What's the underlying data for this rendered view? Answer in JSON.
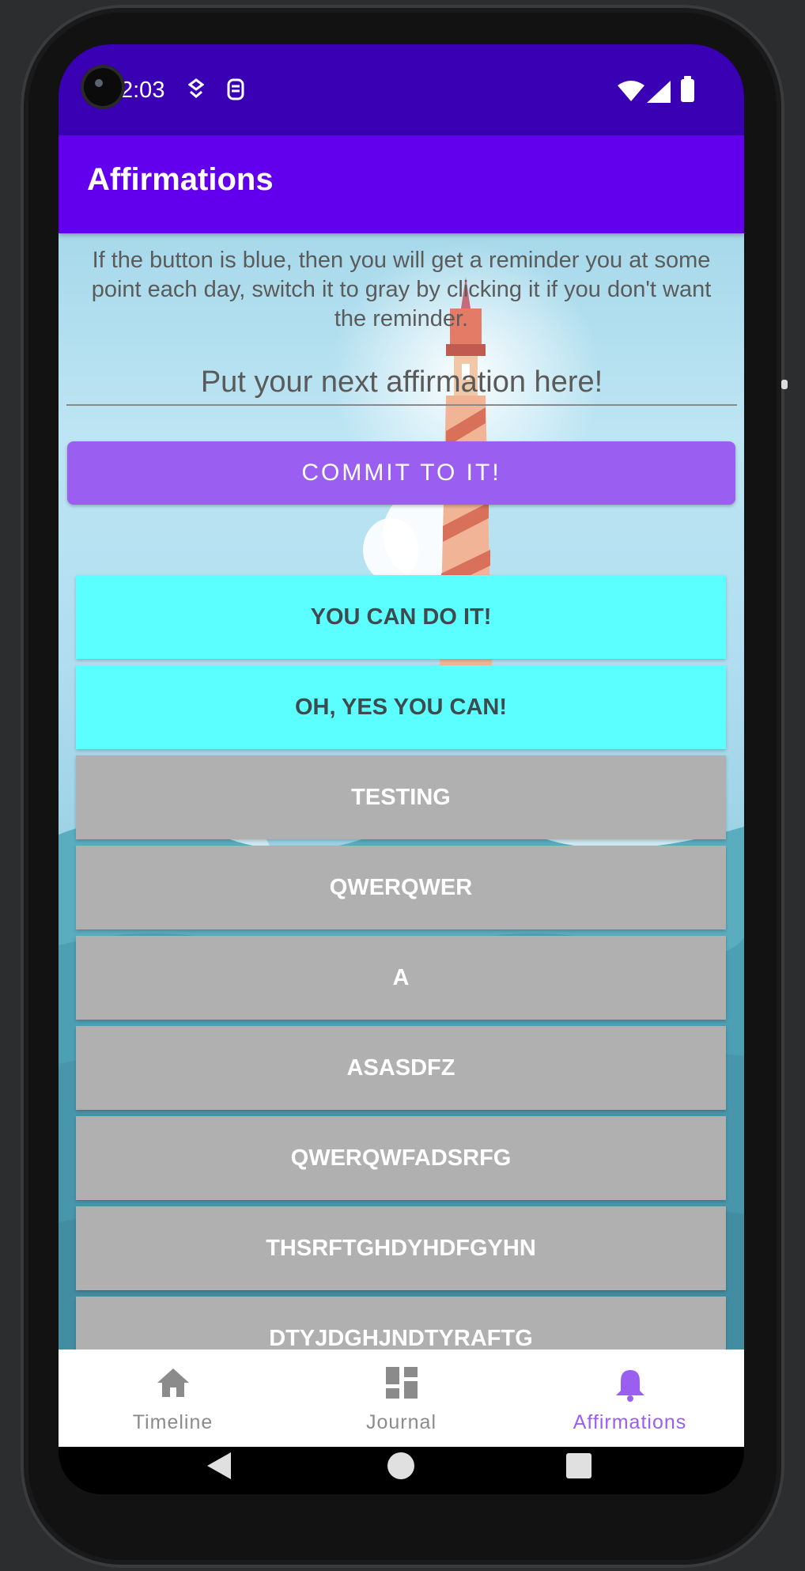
{
  "status_bar": {
    "time": "2:03"
  },
  "app_bar": {
    "title": "Affirmations"
  },
  "content": {
    "info_text": "If the button is blue, then you will get a reminder you at some point each day, switch it to gray by clicking it if you don't want the reminder.",
    "input_placeholder": "Put your next affirmation here!",
    "commit_label": "COMMIT TO IT!"
  },
  "affirmations": [
    {
      "label": "YOU CAN DO IT!",
      "reminder_on": true
    },
    {
      "label": "OH, YES YOU CAN!",
      "reminder_on": true
    },
    {
      "label": "TESTING",
      "reminder_on": false
    },
    {
      "label": "QWERQWER",
      "reminder_on": false
    },
    {
      "label": "A",
      "reminder_on": false
    },
    {
      "label": "ASASDFZ",
      "reminder_on": false
    },
    {
      "label": "QWERQWFADSRFG",
      "reminder_on": false
    },
    {
      "label": "THSRFTGHDYHDFGYHN",
      "reminder_on": false
    },
    {
      "label": "DTYJDGHJNDTYRAFTG",
      "reminder_on": false
    }
  ],
  "bottom_nav": [
    {
      "label": "Timeline",
      "icon": "home-icon",
      "active": false
    },
    {
      "label": "Journal",
      "icon": "dashboard-icon",
      "active": false
    },
    {
      "label": "Affirmations",
      "icon": "bell-icon",
      "active": true
    }
  ],
  "colors": {
    "status_bar": "#3a00b3",
    "app_bar": "#6200ee",
    "accent": "#9a5ff0",
    "reminder_on": "#5cffff",
    "reminder_off": "#b0b0b0"
  }
}
